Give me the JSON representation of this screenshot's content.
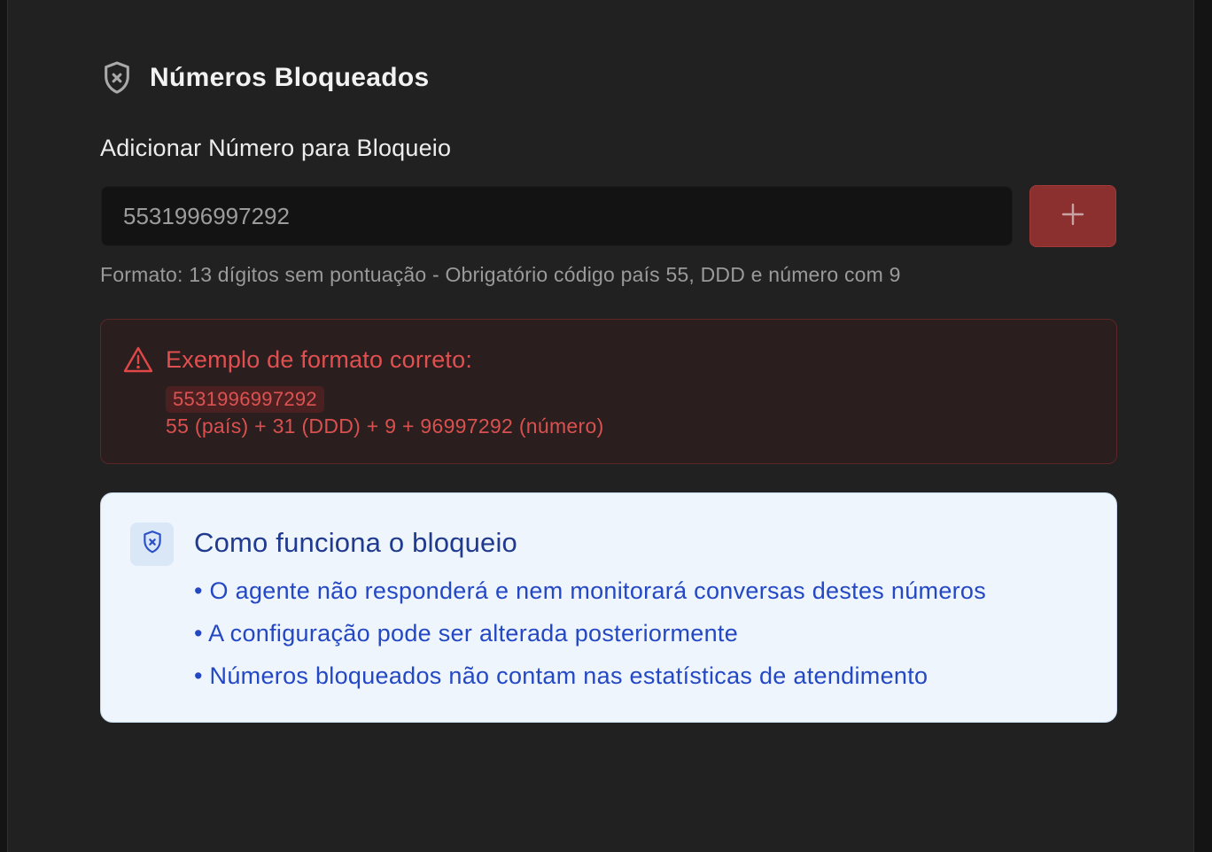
{
  "header": {
    "title": "Números Bloqueados",
    "icon": "shield-x-icon"
  },
  "form": {
    "label": "Adicionar Número para Bloqueio",
    "input_value": "5531996997292",
    "add_button_icon": "plus-icon",
    "hint": "Formato: 13 dígitos sem pontuação - Obrigatório código país 55, DDD e número com 9"
  },
  "example": {
    "icon": "warning-triangle-icon",
    "title": "Exemplo de formato correto:",
    "code": "5531996997292",
    "breakdown": "55 (país) + 31 (DDD) + 9 + 96997292 (número)"
  },
  "info": {
    "icon": "shield-x-icon",
    "title": "Como funciona o bloqueio",
    "items": [
      "• O agente não responderá e nem monitorará conversas destes números",
      "• A configuração pode ser alterada posteriormente",
      "• Números bloqueados não contam nas estatísticas de atendimento"
    ]
  },
  "colors": {
    "panel_bg": "#212121",
    "accent_red": "#8c2f2f",
    "info_blue": "#2448c4",
    "info_bg": "#eef5fd"
  }
}
